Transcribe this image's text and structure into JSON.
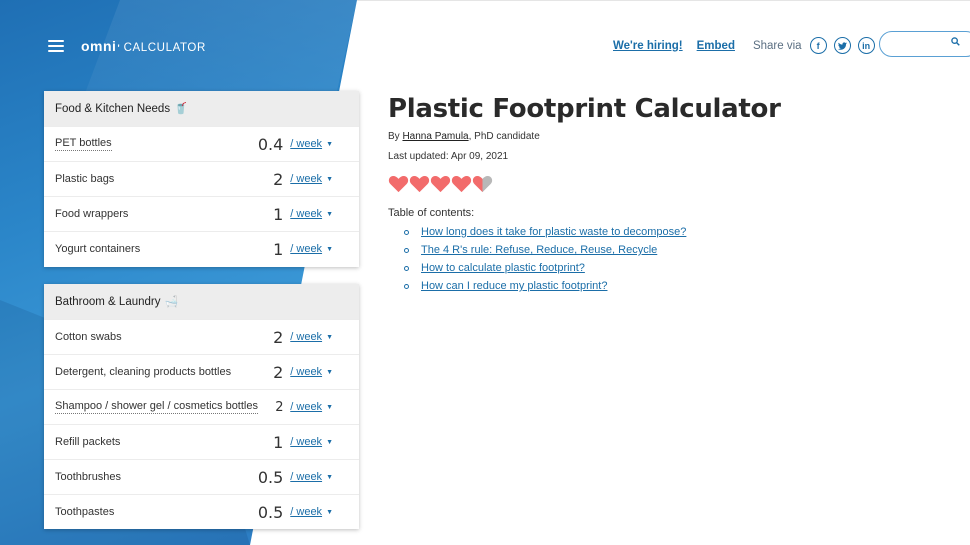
{
  "header": {
    "logo_omni": "omni",
    "logo_calculator": "CALCULATOR",
    "hiring_label": "We're hiring!",
    "embed_label": "Embed",
    "share_label": "Share via",
    "social_icons": [
      "facebook-icon",
      "twitter-icon",
      "linkedin-icon"
    ],
    "search_placeholder": ""
  },
  "food_card": {
    "title": "Food & Kitchen Needs",
    "emoji": "🥤",
    "rows": [
      {
        "label": "PET bottles",
        "value": "0.4",
        "unit": "/ week"
      },
      {
        "label": "Plastic bags",
        "value": "2",
        "unit": "/ week"
      },
      {
        "label": "Food wrappers",
        "value": "1",
        "unit": "/ week"
      },
      {
        "label": "Yogurt containers",
        "value": "1",
        "unit": "/ week"
      }
    ]
  },
  "bath_card": {
    "title": "Bathroom & Laundry",
    "emoji": "🛁",
    "rows": [
      {
        "label": "Cotton swabs",
        "value": "2",
        "unit": "/ week"
      },
      {
        "label": "Detergent, cleaning products bottles",
        "value": "2",
        "unit": "/ week"
      },
      {
        "label": "Shampoo / shower gel / cosmetics bottles",
        "value": "2",
        "unit": "/ week"
      },
      {
        "label": "Refill packets",
        "value": "1",
        "unit": "/ week"
      },
      {
        "label": "Toothbrushes",
        "value": "0.5",
        "unit": "/ week"
      },
      {
        "label": "Toothpastes",
        "value": "0.5",
        "unit": "/ week"
      }
    ]
  },
  "main": {
    "title": "Plastic Footprint Calculator",
    "by_prefix": "By",
    "author": "Hanna Pamula",
    "author_suffix": ", PhD candidate",
    "last_updated": "Last updated: Apr 09, 2021",
    "rating": 4.5,
    "heart_color": "#f26b6b",
    "toc_title": "Table of contents:",
    "toc": [
      "How long does it take for plastic waste to decompose?",
      "The 4 R's rule: Refuse, Reduce, Reuse, Recycle",
      "How to calculate plastic footprint?",
      "How can I reduce my plastic footprint?"
    ]
  },
  "colors": {
    "brand_blue": "#2b86c9",
    "link_blue": "#1b6ea8"
  }
}
